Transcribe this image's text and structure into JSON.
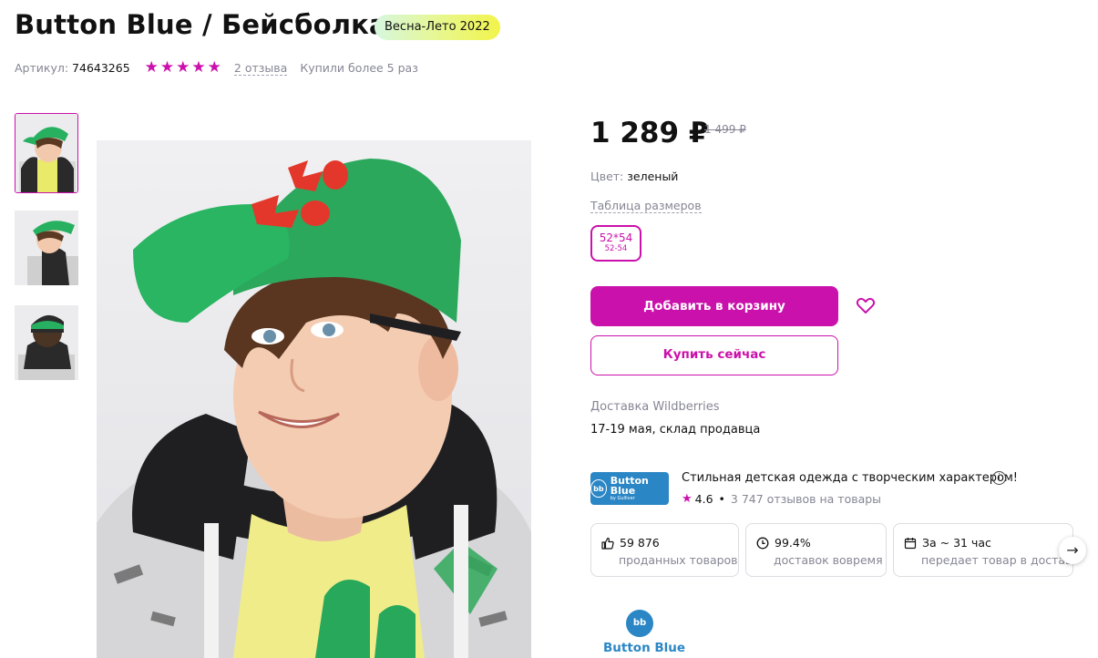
{
  "product": {
    "title": "Button Blue / Бейсболка",
    "season_badge": "Весна-Лето 2022",
    "article_label": "Артикул:",
    "article_value": "74643265",
    "rating_stars": 5,
    "reviews_link": "2 отзыва",
    "bought_text": "Купили более 5 раз"
  },
  "gallery": {
    "thumbnails": [
      {
        "name": "thumb-1",
        "active": true
      },
      {
        "name": "thumb-2",
        "active": false
      },
      {
        "name": "thumb-3",
        "active": false
      }
    ]
  },
  "pricing": {
    "price": "1 289 ₽",
    "old_price": "1 499 ₽"
  },
  "options": {
    "color_label": "Цвет:",
    "color_value": "зеленый",
    "size_table_link": "Таблица размеров",
    "size_selected_main": "52*54",
    "size_selected_sub": "52-54"
  },
  "actions": {
    "add_to_cart": "Добавить в корзину",
    "buy_now": "Купить сейчас"
  },
  "delivery": {
    "label": "Доставка Wildberries",
    "date": "17-19 мая, склад продавца"
  },
  "seller": {
    "logo_text": "Button Blue",
    "logo_sub": "by Gulliver",
    "logo_mark": "bb",
    "description": "Стильная детская одежда с творческим характером!",
    "info_icon": "i",
    "rating": "4.6",
    "reviews": "3 747 отзывов на товары",
    "stats": [
      {
        "value": "59 876",
        "label": "проданных товаров",
        "icon": "thumbs-up-icon"
      },
      {
        "value": "99.4%",
        "label": "доставок вовремя",
        "icon": "clock-icon"
      },
      {
        "value": "За ~ 31 час",
        "label": "передает товар в доставку",
        "icon": "calendar-icon"
      }
    ]
  },
  "brand_bottom": {
    "name": "Button Blue",
    "mark": "bb"
  },
  "colors": {
    "accent": "#cb11ab",
    "brand_blue": "#2b86c5",
    "muted_text": "#868695"
  }
}
